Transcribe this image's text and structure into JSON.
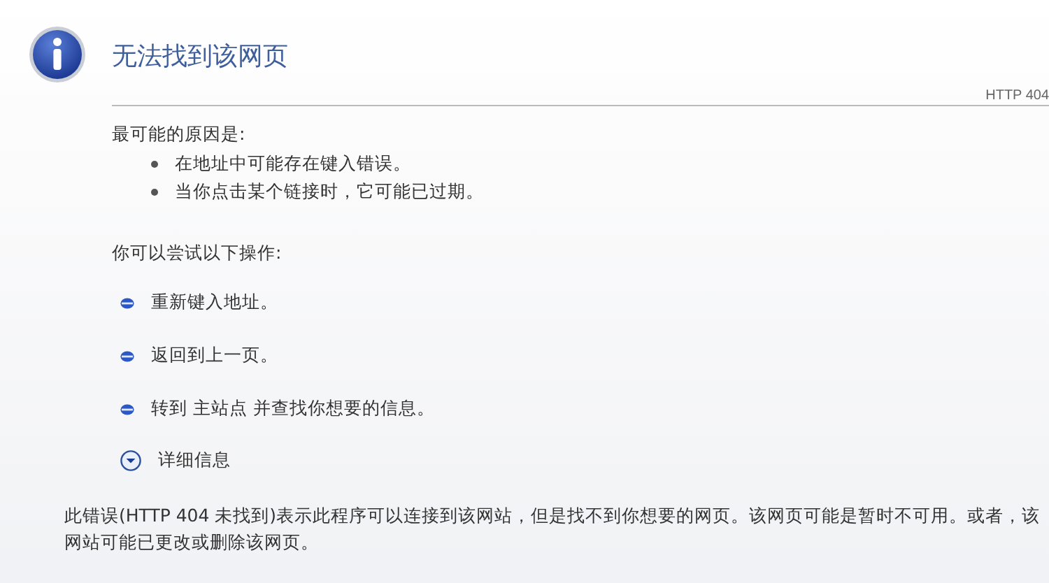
{
  "title": "无法找到该网页",
  "status_code": "HTTP 404",
  "causes": {
    "heading": "最可能的原因是:",
    "items": [
      "在地址中可能存在键入错误。",
      "当你点击某个链接时，它可能已过期。"
    ]
  },
  "actions": {
    "heading": "你可以尝试以下操作:",
    "items": [
      "重新键入地址。",
      "返回到上一页。",
      "转到 主站点 并查找你想要的信息。"
    ]
  },
  "details": {
    "label": "详细信息",
    "expanded": true,
    "text": "此错误(HTTP 404 未找到)表示此程序可以连接到该网站，但是找不到你想要的网页。该网页可能是暂时不可用。或者，该网站可能已更改或删除该网页。"
  }
}
